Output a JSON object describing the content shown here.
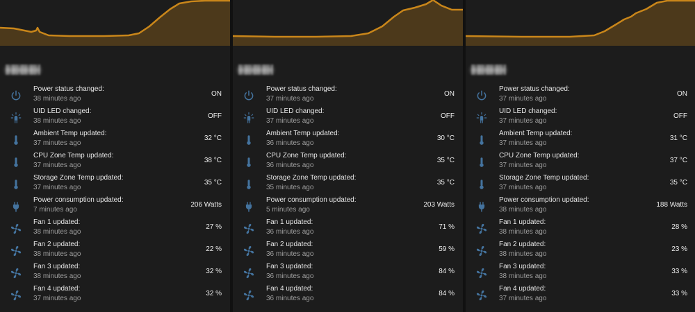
{
  "colors": {
    "accent": "#c9861a",
    "icon": "#44739e",
    "card_bg": "#1c1c1c"
  },
  "cards": [
    {
      "title": "■■■■■■",
      "rows": [
        {
          "icon": "power-icon",
          "name": "Power status changed:",
          "time": "38 minutes ago",
          "value": "ON"
        },
        {
          "icon": "led-icon",
          "name": "UID LED changed:",
          "time": "38 minutes ago",
          "value": "OFF"
        },
        {
          "icon": "thermometer-icon",
          "name": "Ambient Temp updated:",
          "time": "37 minutes ago",
          "value": "32 °C"
        },
        {
          "icon": "thermometer-icon",
          "name": "CPU Zone Temp updated:",
          "time": "37 minutes ago",
          "value": "38 °C"
        },
        {
          "icon": "thermometer-icon",
          "name": "Storage Zone Temp updated:",
          "time": "37 minutes ago",
          "value": "35 °C"
        },
        {
          "icon": "plug-icon",
          "name": "Power consumption updated:",
          "time": "7 minutes ago",
          "value": "206 Watts"
        },
        {
          "icon": "fan-icon",
          "name": "Fan 1 updated:",
          "time": "38 minutes ago",
          "value": "27 %"
        },
        {
          "icon": "fan-icon",
          "name": "Fan 2 updated:",
          "time": "38 minutes ago",
          "value": "22 %"
        },
        {
          "icon": "fan-icon",
          "name": "Fan 3 updated:",
          "time": "38 minutes ago",
          "value": "32 %"
        },
        {
          "icon": "fan-icon",
          "name": "Fan 4 updated:",
          "time": "37 minutes ago",
          "value": "32 %"
        }
      ]
    },
    {
      "title": "■■■■■■",
      "rows": [
        {
          "icon": "power-icon",
          "name": "Power status changed:",
          "time": "37 minutes ago",
          "value": "ON"
        },
        {
          "icon": "led-icon",
          "name": "UID LED changed:",
          "time": "37 minutes ago",
          "value": "OFF"
        },
        {
          "icon": "thermometer-icon",
          "name": "Ambient Temp updated:",
          "time": "36 minutes ago",
          "value": "30 °C"
        },
        {
          "icon": "thermometer-icon",
          "name": "CPU Zone Temp updated:",
          "time": "36 minutes ago",
          "value": "35 °C"
        },
        {
          "icon": "thermometer-icon",
          "name": "Storage Zone Temp updated:",
          "time": "35 minutes ago",
          "value": "35 °C"
        },
        {
          "icon": "plug-icon",
          "name": "Power consumption updated:",
          "time": "5 minutes ago",
          "value": "203 Watts"
        },
        {
          "icon": "fan-icon",
          "name": "Fan 1 updated:",
          "time": "36 minutes ago",
          "value": "71 %"
        },
        {
          "icon": "fan-icon",
          "name": "Fan 2 updated:",
          "time": "36 minutes ago",
          "value": "59 %"
        },
        {
          "icon": "fan-icon",
          "name": "Fan 3 updated:",
          "time": "36 minutes ago",
          "value": "84 %"
        },
        {
          "icon": "fan-icon",
          "name": "Fan 4 updated:",
          "time": "36 minutes ago",
          "value": "84 %"
        }
      ]
    },
    {
      "title": "■■■■■■",
      "rows": [
        {
          "icon": "power-icon",
          "name": "Power status changed:",
          "time": "37 minutes ago",
          "value": "ON"
        },
        {
          "icon": "led-icon",
          "name": "UID LED changed:",
          "time": "37 minutes ago",
          "value": "OFF"
        },
        {
          "icon": "thermometer-icon",
          "name": "Ambient Temp updated:",
          "time": "37 minutes ago",
          "value": "31 °C"
        },
        {
          "icon": "thermometer-icon",
          "name": "CPU Zone Temp updated:",
          "time": "37 minutes ago",
          "value": "37 °C"
        },
        {
          "icon": "thermometer-icon",
          "name": "Storage Zone Temp updated:",
          "time": "37 minutes ago",
          "value": "35 °C"
        },
        {
          "icon": "plug-icon",
          "name": "Power consumption updated:",
          "time": "38 minutes ago",
          "value": "188 Watts"
        },
        {
          "icon": "fan-icon",
          "name": "Fan 1 updated:",
          "time": "38 minutes ago",
          "value": "28 %"
        },
        {
          "icon": "fan-icon",
          "name": "Fan 2 updated:",
          "time": "38 minutes ago",
          "value": "23 %"
        },
        {
          "icon": "fan-icon",
          "name": "Fan 3 updated:",
          "time": "38 minutes ago",
          "value": "33 %"
        },
        {
          "icon": "fan-icon",
          "name": "Fan 4 updated:",
          "time": "37 minutes ago",
          "value": "33 %"
        }
      ]
    }
  ]
}
